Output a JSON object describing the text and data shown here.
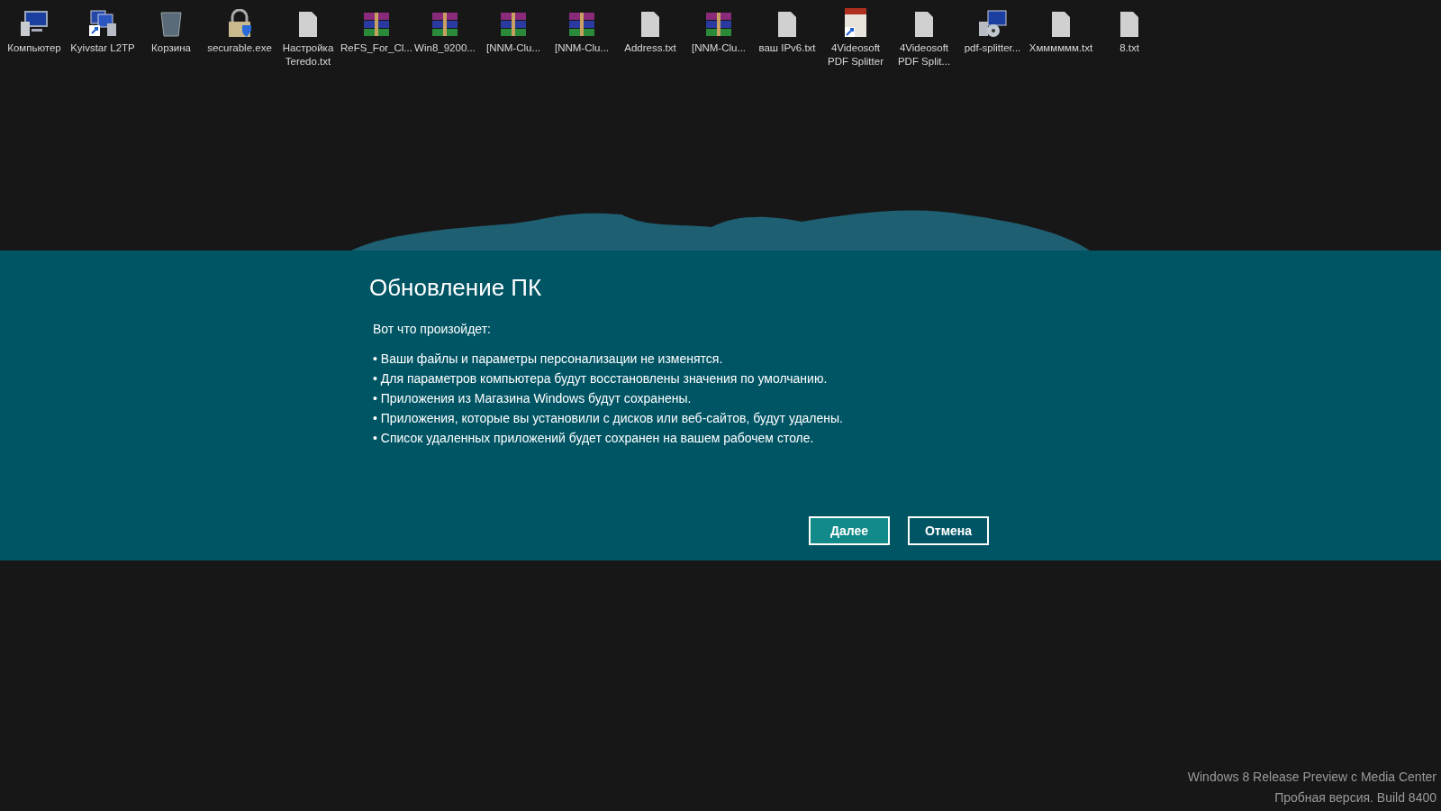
{
  "desktop_icons": [
    {
      "label": "Компьютер",
      "kind": "computer"
    },
    {
      "label": "Kyivstar L2TP",
      "kind": "network"
    },
    {
      "label": "Корзина",
      "kind": "bin"
    },
    {
      "label": "securable.exe",
      "kind": "lock"
    },
    {
      "label": "Настройка Teredo.txt",
      "kind": "text"
    },
    {
      "label": "ReFS_For_Cl...",
      "kind": "archive"
    },
    {
      "label": "Win8_9200...",
      "kind": "archive"
    },
    {
      "label": "[NNM-Clu...",
      "kind": "archive"
    },
    {
      "label": "[NNM-Clu...",
      "kind": "archive"
    },
    {
      "label": "Address.txt",
      "kind": "text"
    },
    {
      "label": "[NNM-Clu...",
      "kind": "archive"
    },
    {
      "label": "ваш IPv6.txt",
      "kind": "text"
    },
    {
      "label": "4Videosoft PDF Splitter",
      "kind": "pdf"
    },
    {
      "label": "4Videosoft PDF Split...",
      "kind": "text"
    },
    {
      "label": "pdf-splitter...",
      "kind": "installer"
    },
    {
      "label": "Хмммммм.txt",
      "kind": "text"
    },
    {
      "label": "8.txt",
      "kind": "text"
    }
  ],
  "dialog": {
    "title": "Обновление ПК",
    "intro": "Вот что произойдет:",
    "bullets": [
      "• Ваши файлы и параметры персонализации не изменятся.",
      "• Для параметров компьютера будут восстановлены значения по умолчанию.",
      "• Приложения из Магазина Windows будут сохранены.",
      "• Приложения, которые вы установили с дисков или веб-сайтов, будут удалены.",
      "• Список удаленных приложений будет сохранен на вашем рабочем столе."
    ],
    "buttons": [
      {
        "label": "Далее",
        "kind": "primary"
      },
      {
        "label": "Отмена",
        "kind": "secondary"
      }
    ]
  },
  "watermark": [
    "Windows 8 Release Preview с Media Center",
    "Пробная версия. Build 8400"
  ]
}
